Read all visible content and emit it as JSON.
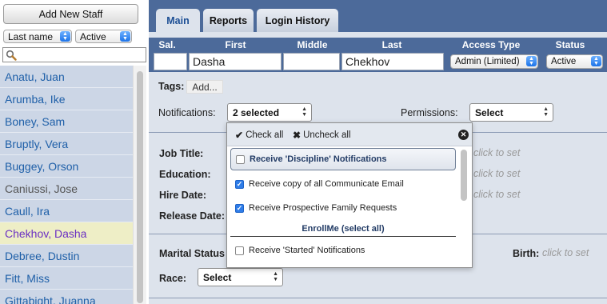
{
  "sidebar": {
    "add_button_label": "Add New Staff",
    "sort_select": "Last name",
    "status_select": "Active",
    "search_placeholder": "",
    "staff": [
      {
        "name": "Anatu, Juan"
      },
      {
        "name": "Arumba, Ike"
      },
      {
        "name": "Boney, Sam"
      },
      {
        "name": "Bruptly, Vera"
      },
      {
        "name": "Buggey, Orson"
      },
      {
        "name": "Caniussi, Jose"
      },
      {
        "name": "Caull, Ira"
      },
      {
        "name": "Chekhov, Dasha"
      },
      {
        "name": "Debree, Dustin"
      },
      {
        "name": "Fitt, Miss"
      },
      {
        "name": "Gittabight, Juanna"
      }
    ]
  },
  "tabs": [
    "Main",
    "Reports",
    "Login History"
  ],
  "header": {
    "sal": "Sal.",
    "first": "First",
    "middle": "Middle",
    "last": "Last",
    "access_type": "Access Type",
    "status": "Status"
  },
  "person": {
    "sal": "",
    "first": "Dasha",
    "middle": "",
    "last": "Chekhov",
    "access_type": "Admin (Limited)",
    "status": "Active"
  },
  "tags": {
    "label": "Tags:",
    "add_button": "Add..."
  },
  "notifications": {
    "label": "Notifications:",
    "value": "2 selected"
  },
  "permissions": {
    "label": "Permissions:",
    "value": "Select"
  },
  "fields": {
    "job_title": "Job Title:",
    "education": "Education:",
    "hire_date": "Hire Date:",
    "release_date": "Release Date:",
    "marital_status": "Marital Status",
    "birth": "Birth:",
    "race": "Race:",
    "race_value": "Select",
    "click_to_set": "click to set"
  },
  "popup": {
    "check_all": "Check all",
    "uncheck_all": "Uncheck all",
    "options": [
      {
        "label": "Receive 'Discipline' Notifications",
        "checked": false
      },
      {
        "label": "Receive copy of all Communicate Email",
        "checked": true
      },
      {
        "label": "Receive Prospective Family Requests",
        "checked": true
      }
    ],
    "group_label": "EnrollMe (select all)",
    "group_options": [
      {
        "label": "Receive 'Started' Notifications",
        "checked": false
      }
    ]
  },
  "colors": {
    "tab_bar": "#4c6a9a",
    "panel_bg": "#dde3ec",
    "list_bg": "#ccd6e6",
    "selected_row": "#eeeec6",
    "link_text": "#1e5fa8"
  }
}
